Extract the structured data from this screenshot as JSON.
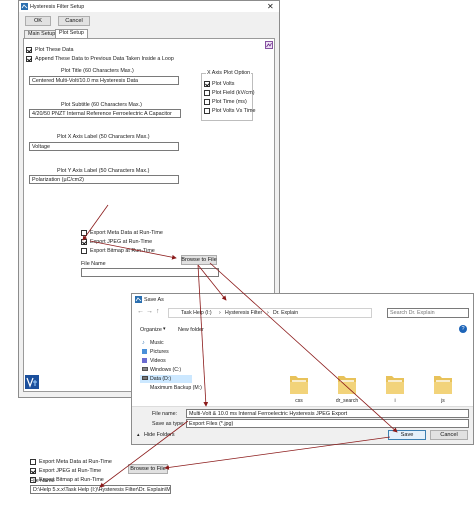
{
  "setup": {
    "title": "Hysteresis Filter Setup",
    "ok_label": "OK",
    "cancel_label": "Cancel",
    "tabs": [
      {
        "label": "Main Setup"
      },
      {
        "label": "Plot Setup"
      }
    ],
    "plot_these_data": "Plot These Data",
    "append_label": "Append These Data to Previous Data Taken Inside a Loop",
    "plot_title_label": "Plot Title (60 Characters Max.)",
    "plot_title_value": "Centered Multi-Volt/10.0 ms Hysteresis Data",
    "plot_subtitle_label": "Plot Subtitle (60 Characters Max.)",
    "plot_subtitle_value": "4/20/50 PNZT Internal Reference Ferroelectric A Capacitor",
    "x_axis_label": "Plot X Axis Label (50 Characters Max.)",
    "x_axis_value": "Voltage",
    "y_axis_label": "Plot Y Axis Label (50 Characters Max.)",
    "y_axis_value": "Polarization (µC/cm2)",
    "x_axis_option_title": "X Axis Plot Option",
    "x_options": [
      {
        "label": "Plot Volts",
        "checked": true
      },
      {
        "label": "Plot Field (kV/cm)",
        "checked": false
      },
      {
        "label": "Plot Time (ms)",
        "checked": false
      },
      {
        "label": "Plot Volts Vs Time",
        "checked": false
      }
    ],
    "export_meta": "Export Meta Data at Run-Time",
    "export_jpeg": "Export JPEG at Run-Time",
    "export_bitmap": "Export Bitmap at Run-Time",
    "browse_label": "Browse to File",
    "file_name_label": "File Name"
  },
  "saveas": {
    "title": "Save As",
    "breadcrumb": [
      "Task Help (I:)",
      "Hysteresis Filter",
      "Dr. Explain"
    ],
    "search_placeholder": "Search Dr. Explain",
    "organize_label": "Organize",
    "new_folder_label": "New folder",
    "nav_items": [
      "Music",
      "Pictures",
      "Videos",
      "Windows (C:)",
      "Data (D:)",
      "Maximum Backup (M:)"
    ],
    "folders": [
      "css",
      "dr_search",
      "i",
      "js"
    ],
    "file_name_label": "File name:",
    "file_name_value": "Multi-Volt & 10.0 ms Internal Ferroelectric Hysteresis JPEG Export",
    "save_type_label": "Save as type:",
    "save_type_value": "Export Files (*.jpg)",
    "hide_folders_label": "Hide Folders",
    "save_label": "Save",
    "cancel_label": "Cancel"
  },
  "zoom": {
    "export_meta": "Export Meta Data at Run-Time",
    "export_jpeg": "Export JPEG at Run-Time",
    "export_bitmap": "Export Bitmap at Run-Time",
    "browse_label": "Browse to File",
    "file_name_label": "File Name",
    "file_name_value": "D:\\Help 5.x.x\\Task Help (I:)\\Hysteresis Filter\\Dr. Explain\\Multi-"
  },
  "colors": {
    "accent": "#0078d7",
    "arrow": "#8b1a1a",
    "folder": "#e8c25a"
  }
}
